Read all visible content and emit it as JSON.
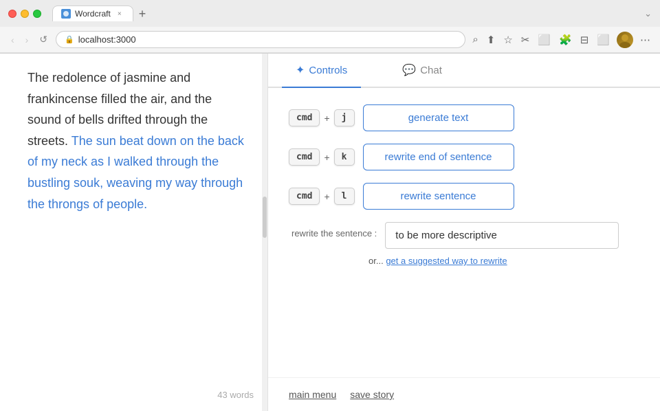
{
  "browser": {
    "tab_title": "Wordcraft",
    "tab_favicon": "W",
    "address": "localhost:3000",
    "new_tab_label": "+",
    "close_label": "×"
  },
  "nav": {
    "back_label": "‹",
    "forward_label": "›",
    "reload_label": "↺",
    "actions": [
      "⌕",
      "⬆",
      "☆",
      "✂",
      "⬜",
      "🧩",
      "⊟",
      "⬜"
    ],
    "more_label": "⋯"
  },
  "editor": {
    "content_normal_1": "The redolence of jasmine and frankincense filled the air, and the sound of bells drifted through the streets. ",
    "content_highlighted": "The sun beat down on the back of my neck as I walked through the bustling souk, weaving my way through the throngs of people.",
    "word_count": "43 words"
  },
  "controls_tab": {
    "label": "Controls",
    "icon": "✦"
  },
  "chat_tab": {
    "label": "Chat",
    "icon": "💬"
  },
  "shortcuts": [
    {
      "mod_key": "cmd",
      "plus": "+",
      "letter_key": "j",
      "action_label": "generate text"
    },
    {
      "mod_key": "cmd",
      "plus": "+",
      "letter_key": "k",
      "action_label": "rewrite end of sentence"
    },
    {
      "mod_key": "cmd",
      "plus": "+",
      "letter_key": "l",
      "action_label": "rewrite sentence"
    }
  ],
  "rewrite_section": {
    "label": "rewrite the sentence :",
    "input_value": "to be more descriptive",
    "or_text": "or...",
    "suggest_link_text": "get a suggested way to rewrite"
  },
  "footer": {
    "main_menu_label": "main menu",
    "save_story_label": "save story"
  }
}
